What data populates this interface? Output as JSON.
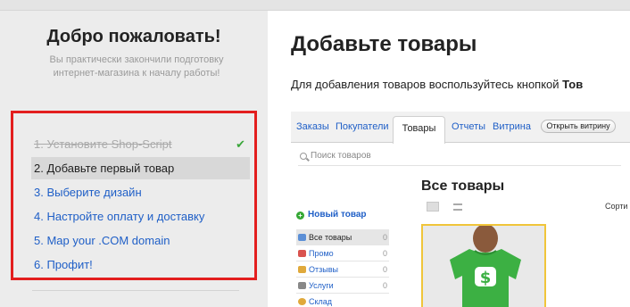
{
  "sidebar": {
    "title": "Добро пожаловать!",
    "subtitle": "Вы практически закончили подготовку интернет-магазина к началу работы!",
    "steps": [
      {
        "label": "1. Установите Shop-Script",
        "state": "done"
      },
      {
        "label": "2. Добавьте первый товар",
        "state": "active"
      },
      {
        "label": "3. Выберите дизайн",
        "state": "todo"
      },
      {
        "label": "4. Настройте оплату и доставку",
        "state": "todo"
      },
      {
        "label": "5. Map your .COM domain",
        "state": "todo"
      },
      {
        "label": "6. Профит!",
        "state": "todo"
      }
    ],
    "highlight_color": "#e31e1e",
    "check_icon": "check-icon"
  },
  "main": {
    "title": "Добавьте товары",
    "desc_prefix": "Для добавления товаров воспользуйтесь кнопкой ",
    "desc_bold": "Тов"
  },
  "mini": {
    "tabs": [
      "Заказы",
      "Покупатели",
      "Товары",
      "Отчеты",
      "Витрина"
    ],
    "active_tab": "Товары",
    "open_storefront": "Открыть витрину",
    "search_placeholder": "Поиск товаров",
    "new_product": "Новый товар",
    "heading": "Все товары",
    "sort_label": "Сорти",
    "nav": [
      {
        "label": "Все товары",
        "count": "0",
        "icon": "stack-icon",
        "color": "#5c8fd6"
      },
      {
        "label": "Промо",
        "count": "0",
        "icon": "promo-icon",
        "color": "#d9534f"
      },
      {
        "label": "Отзывы",
        "count": "0",
        "icon": "reviews-icon",
        "color": "#e0a93b"
      },
      {
        "label": "Услуги",
        "count": "0",
        "icon": "services-icon",
        "color": "#888888"
      },
      {
        "label": "Склад",
        "count": "",
        "icon": "warehouse-icon",
        "color": "#e0a93b"
      }
    ],
    "product_color": "#3cb043",
    "product_border": "#f0c53a"
  }
}
